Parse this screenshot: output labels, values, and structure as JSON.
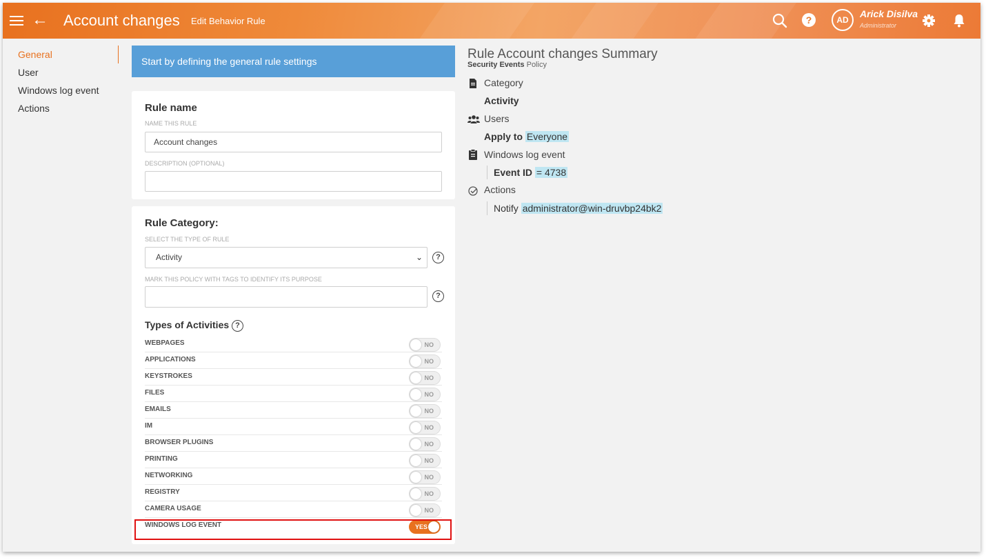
{
  "header": {
    "title": "Account changes",
    "subtitle": "Edit Behavior Rule",
    "user_initials": "AD",
    "user_name": "Arick Disilva",
    "user_role": "Administrator",
    "help_glyph": "?",
    "colors": {
      "accent": "#e8711f",
      "accent_light": "#f3a565"
    }
  },
  "nav": {
    "items": [
      {
        "label": "General",
        "active": true
      },
      {
        "label": "User"
      },
      {
        "label": "Windows log event"
      },
      {
        "label": "Actions"
      }
    ]
  },
  "banner": {
    "text": "Start by defining the general rule settings",
    "color": "#589fd8"
  },
  "rule_name": {
    "heading": "Rule name",
    "name_label": "NAME THIS RULE",
    "name_value": "Account changes",
    "desc_label": "DESCRIPTION (OPTIONAL)",
    "desc_value": ""
  },
  "rule_category": {
    "heading": "Rule Category:",
    "type_label": "SELECT THE TYPE OF RULE",
    "type_value": "Activity",
    "tags_label": "MARK THIS POLICY WITH TAGS TO IDENTIFY ITS PURPOSE",
    "tags_value": "",
    "activities_heading": "Types of Activities",
    "activities": [
      {
        "label": "WEBPAGES",
        "state": "NO"
      },
      {
        "label": "APPLICATIONS",
        "state": "NO"
      },
      {
        "label": "KEYSTROKES",
        "state": "NO"
      },
      {
        "label": "FILES",
        "state": "NO"
      },
      {
        "label": "EMAILS",
        "state": "NO"
      },
      {
        "label": "IM",
        "state": "NO"
      },
      {
        "label": "BROWSER PLUGINS",
        "state": "NO"
      },
      {
        "label": "PRINTING",
        "state": "NO"
      },
      {
        "label": "NETWORKING",
        "state": "NO"
      },
      {
        "label": "REGISTRY",
        "state": "NO"
      },
      {
        "label": "CAMERA USAGE",
        "state": "NO"
      },
      {
        "label": "WINDOWS LOG EVENT",
        "state": "YES"
      }
    ]
  },
  "summary": {
    "title": "Rule Account changes Summary",
    "policy_bold": "Security Events",
    "policy_rest": " Policy",
    "category_head": "Category",
    "category_value": "Activity",
    "users_head": "Users",
    "users_prefix": "Apply to ",
    "users_value": "Everyone",
    "event_head": "Windows log event",
    "event_prefix": "Event ID ",
    "event_value": "= 4738",
    "actions_head": "Actions",
    "actions_prefix": "Notify ",
    "actions_value": "administrator@win-druvbp24bk2",
    "highlight_color": "#bfe6f2"
  }
}
